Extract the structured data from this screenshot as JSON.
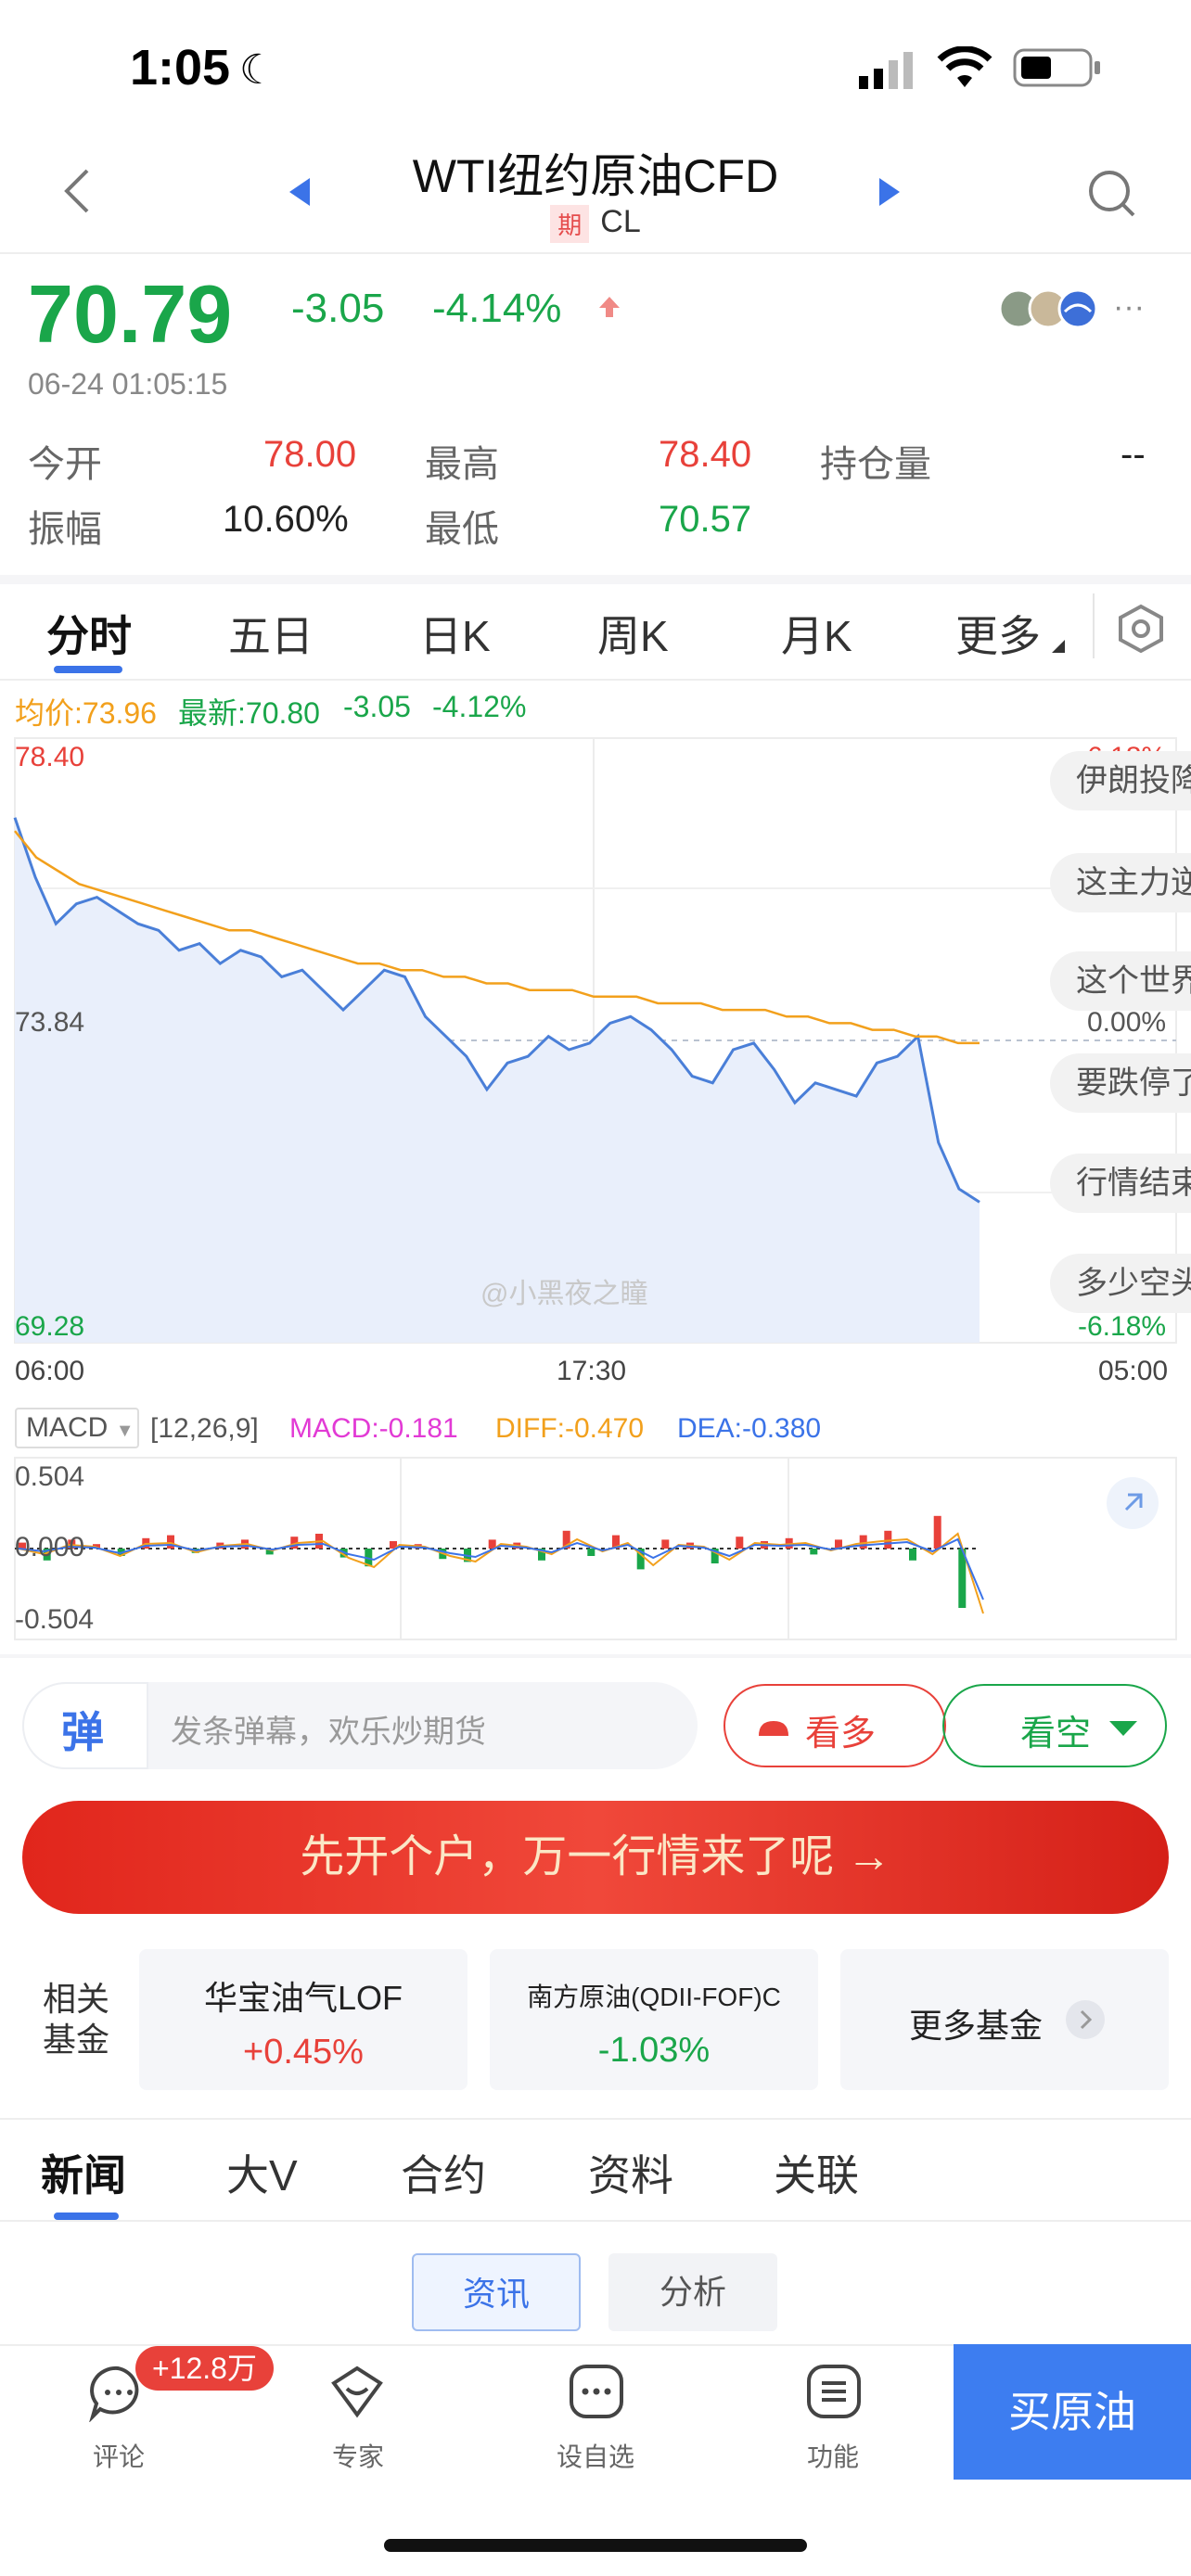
{
  "status_bar": {
    "time": "1:05"
  },
  "nav": {
    "title": "WTI纽约原油CFD",
    "badge": "期",
    "code": "CL"
  },
  "quote": {
    "price": "70.79",
    "change": "-3.05",
    "change_pct": "-4.14%",
    "timestamp": "06-24 01:05:15",
    "open_label": "今开",
    "open": "78.00",
    "high_label": "最高",
    "high": "78.40",
    "oi_label": "持仓量",
    "oi": "--",
    "amp_label": "振幅",
    "amp": "10.60%",
    "low_label": "最低",
    "low": "70.57"
  },
  "tabs": [
    "分时",
    "五日",
    "日K",
    "周K",
    "月K",
    "更多"
  ],
  "chart_legend": {
    "avg": "均价:73.96",
    "last": "最新:70.80",
    "chg": "-3.05",
    "pct": "-4.12%"
  },
  "chart_data": {
    "type": "line",
    "y_labels": {
      "top": "78.40",
      "mid": "73.84",
      "bottom": "69.28"
    },
    "right_labels": {
      "top": "6.18%",
      "mid": "0.00%",
      "bottom": "-6.18%"
    },
    "x_labels": [
      "06:00",
      "17:30",
      "05:00"
    ],
    "ylim": [
      69.28,
      78.4
    ],
    "series": [
      {
        "name": "最新",
        "color": "#4a7fd8",
        "values": [
          77.2,
          76.3,
          75.6,
          75.9,
          76.0,
          75.8,
          75.6,
          75.5,
          75.2,
          75.3,
          75.0,
          75.2,
          75.1,
          74.8,
          74.9,
          74.6,
          74.3,
          74.6,
          74.9,
          74.8,
          74.2,
          73.9,
          73.6,
          73.1,
          73.5,
          73.6,
          73.9,
          73.7,
          73.8,
          74.1,
          74.2,
          74.0,
          73.7,
          73.3,
          73.2,
          73.7,
          73.8,
          73.4,
          72.9,
          73.2,
          73.1,
          73.0,
          73.5,
          73.6,
          73.9,
          72.3,
          71.6,
          71.4
        ]
      },
      {
        "name": "均价",
        "color": "#f2a01c",
        "values": [
          77.0,
          76.6,
          76.4,
          76.2,
          76.1,
          76.0,
          75.9,
          75.8,
          75.7,
          75.6,
          75.5,
          75.5,
          75.4,
          75.3,
          75.2,
          75.1,
          75.0,
          75.0,
          74.9,
          74.9,
          74.8,
          74.8,
          74.7,
          74.7,
          74.6,
          74.6,
          74.6,
          74.5,
          74.5,
          74.5,
          74.4,
          74.4,
          74.4,
          74.3,
          74.3,
          74.3,
          74.2,
          74.2,
          74.1,
          74.1,
          74.0,
          74.0,
          73.9,
          73.9,
          73.8,
          73.8
        ]
      }
    ]
  },
  "bubbles": [
    "伊朗投降",
    "这主力逆",
    "这个世界",
    "要跌停了",
    "行情结束",
    "多少空头"
  ],
  "watermark": "@小黑夜之瞳",
  "macd": {
    "label": "MACD",
    "params": "[12,26,9]",
    "macd": "MACD:-0.181",
    "diff": "DIFF:-0.470",
    "dea": "DEA:-0.380",
    "top": "0.504",
    "mid": "0.000",
    "bottom": "-0.504"
  },
  "danmu": {
    "icon": "弹",
    "placeholder": "发条弹幕，欢乐炒期货",
    "bull": "看多",
    "bear": "看空"
  },
  "cta": "先开个户，万一行情来了呢 →",
  "funds": {
    "label": "相关基金",
    "items": [
      {
        "name": "华宝油气LOF",
        "pct": "+0.45%"
      },
      {
        "name": "南方原油(QDII-FOF)C",
        "pct": "-1.03%"
      }
    ],
    "more": "更多基金"
  },
  "lower_tabs": [
    "新闻",
    "大V",
    "合约",
    "资料",
    "关联"
  ],
  "segments": {
    "a": "资讯",
    "b": "分析"
  },
  "bottom_bar": {
    "comment": "评论",
    "comment_badge": "+12.8万",
    "expert": "专家",
    "watch": "设自选",
    "func": "功能",
    "buy": "买原油"
  }
}
